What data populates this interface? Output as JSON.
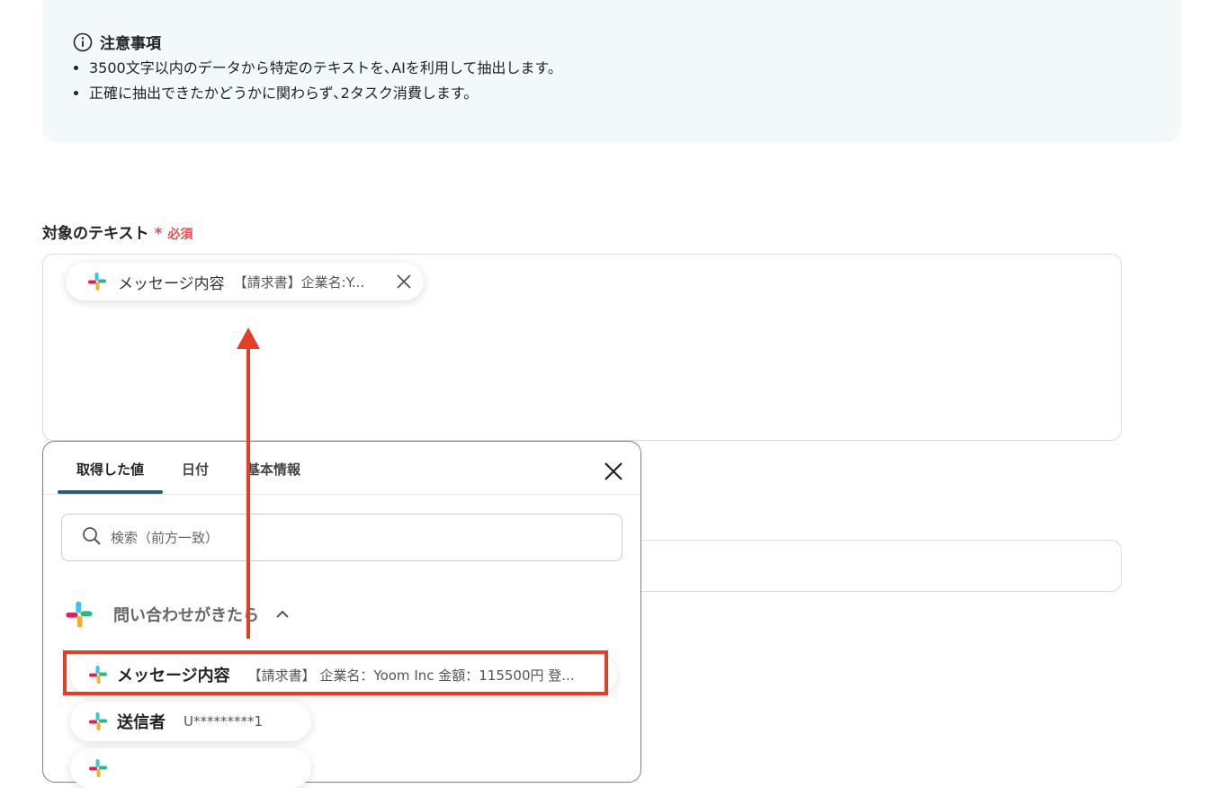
{
  "notice": {
    "title": "注意事項",
    "items": [
      "3500文字以内のデータから特定のテキストを､AIを利用して抽出します。",
      "正確に抽出できたかどうかに関わらず､2タスク消費します。"
    ]
  },
  "field": {
    "label": "対象のテキスト",
    "required_mark": "*",
    "required_text": "必須"
  },
  "chip": {
    "label": "メッセージ内容",
    "value": "【請求書】企業名:Y..."
  },
  "panel": {
    "tabs": [
      "取得した値",
      "日付",
      "基本情報"
    ],
    "active_tab": 0,
    "search_placeholder": "検索（前方一致）",
    "group_label": "問い合わせがきたら",
    "items": [
      {
        "label": "メッセージ内容",
        "value": "【請求書】 企業名：Yoom Inc 金額：115500円 登..."
      },
      {
        "label": "送信者",
        "value": "U*********1"
      },
      {
        "label": "",
        "value": ""
      }
    ]
  },
  "colors": {
    "highlight": "#e43f26",
    "required": "#e05050",
    "tab_indicator": "#2c5f70",
    "notice_bg": "#f3f8f8"
  }
}
